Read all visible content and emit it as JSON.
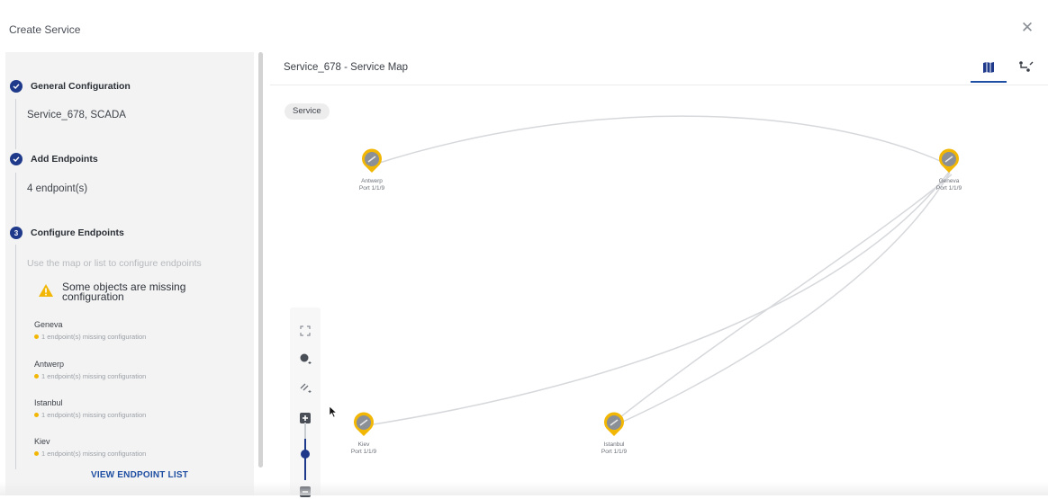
{
  "dialog": {
    "title": "Create Service",
    "close_icon": "close-icon"
  },
  "steps": [
    {
      "number": "1",
      "title": "General Configuration",
      "value": "Service_678, SCADA",
      "state": "complete"
    },
    {
      "number": "2",
      "title": "Add Endpoints",
      "value": "4 endpoint(s)",
      "state": "complete"
    },
    {
      "number": "3",
      "title": "Configure Endpoints",
      "hint": "Use the map or list to configure endpoints",
      "state": "active"
    }
  ],
  "warning": {
    "icon": "warning-icon",
    "text": "Some objects are missing configuration"
  },
  "endpoints": [
    {
      "name": "Geneva",
      "status": "1 endpoint(s) missing configuration"
    },
    {
      "name": "Antwerp",
      "status": "1 endpoint(s) missing configuration"
    },
    {
      "name": "Istanbul",
      "status": "1 endpoint(s) missing configuration"
    },
    {
      "name": "Kiev",
      "status": "1 endpoint(s) missing configuration"
    }
  ],
  "view_list_label": "VIEW ENDPOINT LIST",
  "map": {
    "title": "Service_678 - Service Map",
    "tabs": [
      {
        "name": "map-view",
        "icon": "map-icon",
        "active": true
      },
      {
        "name": "route-view",
        "icon": "route-icon",
        "active": false
      }
    ],
    "service_chip": "Service",
    "nodes": [
      {
        "name": "Antwerp",
        "port": "Port 1/1/9"
      },
      {
        "name": "Geneva",
        "port": "Port 1/1/9"
      },
      {
        "name": "Kiev",
        "port": "Port 1/1/9"
      },
      {
        "name": "Istanbul",
        "port": "Port 1/1/9"
      }
    ],
    "links": [
      [
        "Antwerp",
        "Geneva"
      ],
      [
        "Kiev",
        "Geneva"
      ],
      [
        "Istanbul",
        "Geneva"
      ],
      [
        "Istanbul",
        "Geneva"
      ]
    ],
    "toolbar": [
      "fit-to-screen-icon",
      "add-node-icon",
      "add-link-icon",
      "zoom-in-icon",
      "zoom-out-icon"
    ],
    "zoom_level": 0.5
  },
  "colors": {
    "accent": "#1f3a8a",
    "link": "#1f4fa3",
    "node_ring": "#f2b705",
    "node_fill": "#8b8f96",
    "warning": "#f2b705"
  }
}
